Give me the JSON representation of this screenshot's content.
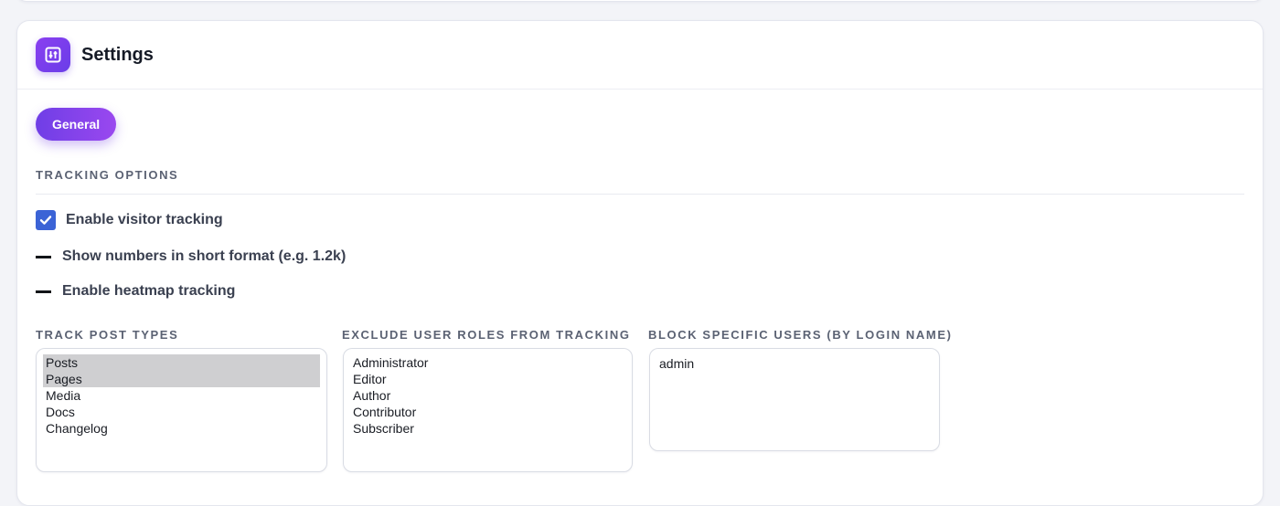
{
  "header": {
    "title": "Settings",
    "icon": "sliders-square-icon",
    "icon_color": "#7b3fee"
  },
  "tabs": [
    {
      "label": "General",
      "active": true
    }
  ],
  "tracking": {
    "heading": "TRACKING OPTIONS",
    "options": [
      {
        "label": "Enable visitor tracking",
        "state": "checked"
      },
      {
        "label": "Show numbers in short format (e.g. 1.2k)",
        "state": "unchecked"
      },
      {
        "label": "Enable heatmap tracking",
        "state": "unchecked"
      }
    ]
  },
  "post_types": {
    "label": "TRACK POST TYPES",
    "options": [
      {
        "label": "Posts",
        "selected": true
      },
      {
        "label": "Pages",
        "selected": true
      },
      {
        "label": "Media",
        "selected": false
      },
      {
        "label": "Docs",
        "selected": false
      },
      {
        "label": "Changelog",
        "selected": false
      }
    ]
  },
  "exclude_roles": {
    "label": "EXCLUDE USER ROLES FROM TRACKING",
    "options": [
      {
        "label": "Administrator",
        "selected": false
      },
      {
        "label": "Editor",
        "selected": false
      },
      {
        "label": "Author",
        "selected": false
      },
      {
        "label": "Contributor",
        "selected": false
      },
      {
        "label": "Subscriber",
        "selected": false
      }
    ]
  },
  "block_users": {
    "label": "BLOCK SPECIFIC USERS (BY LOGIN NAME)",
    "value": "admin"
  },
  "colors": {
    "accent": "#7b3fee",
    "checkbox": "#3b63d6"
  }
}
